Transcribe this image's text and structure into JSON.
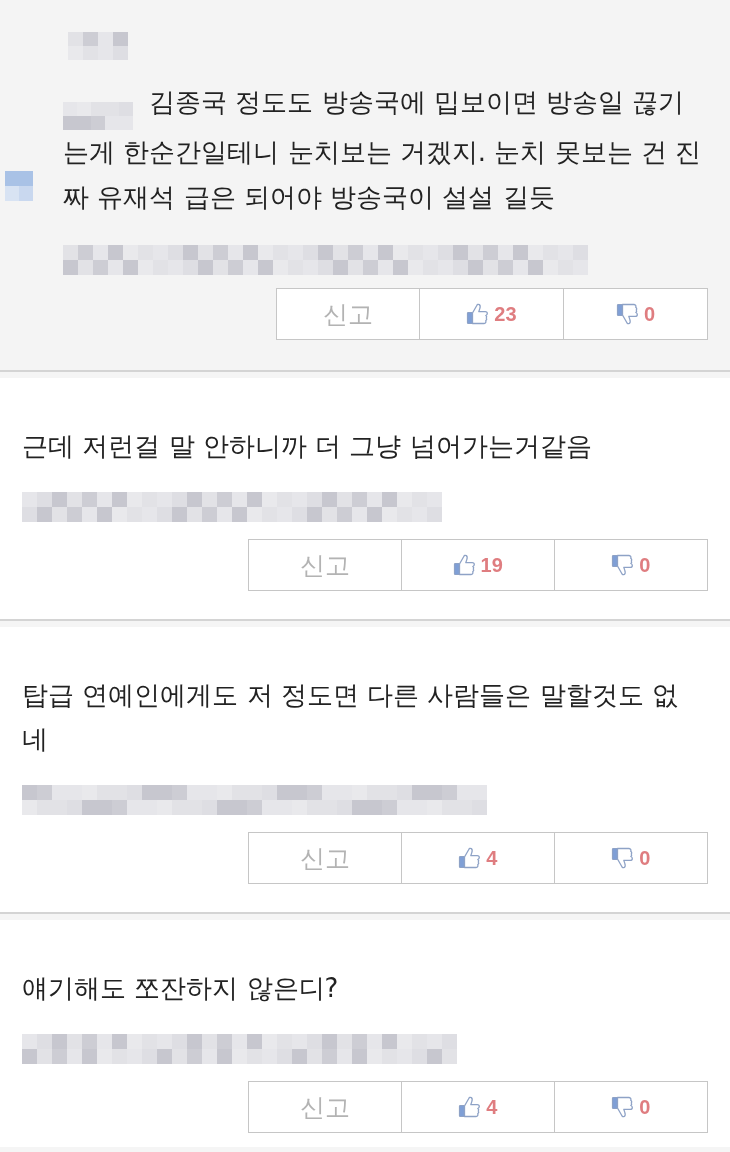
{
  "comments": [
    {
      "kind": "reply",
      "text": "김종국 정도도 방송국에 밉보이면 방송일 끊기는게 한순간일테니 눈치보는 거겠지. 눈치 못보는 건 진짜 유재석 급은 되어야 방송국이 설설 길듯",
      "report_label": "신고",
      "likes": "23",
      "dislikes": "0"
    },
    {
      "kind": "comment",
      "text": "근데 저런걸 말 안하니까 더 그냥 넘어가는거같음",
      "report_label": "신고",
      "likes": "19",
      "dislikes": "0"
    },
    {
      "kind": "comment",
      "text": "탑급 연예인에게도 저 정도면 다른 사람들은 말할것도 없네",
      "report_label": "신고",
      "likes": "4",
      "dislikes": "0"
    },
    {
      "kind": "comment",
      "text": "얘기해도 쪼잔하지 않은디?",
      "report_label": "신고",
      "likes": "4",
      "dislikes": "0"
    }
  ]
}
